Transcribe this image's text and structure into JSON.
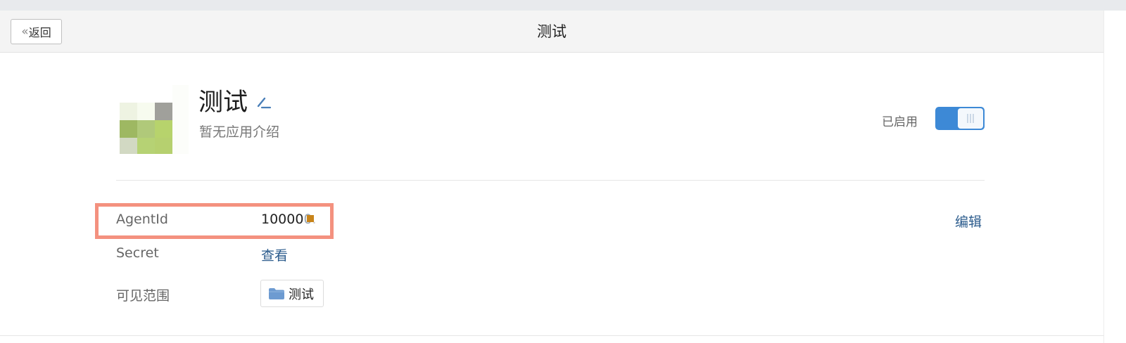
{
  "header": {
    "back_label": "返回",
    "back_chevron": "«",
    "title": "测试"
  },
  "app": {
    "name": "测试",
    "description": "暂无应用介绍",
    "status_label": "已启用",
    "enabled": true,
    "accent_color": "#3d89d6"
  },
  "details": {
    "agentid_label": "AgentId",
    "agentid_value": "10000",
    "agentid_value_suffix": "0",
    "secret_label": "Secret",
    "secret_link": "查看",
    "scope_label": "可见范围",
    "scope_value": "测试",
    "edit_label": "编辑"
  },
  "icons": {
    "back": "double-chevron-left-icon",
    "edit_name": "pencil-icon",
    "scope": "folder-icon",
    "logo": "app-logo-pixelated"
  },
  "colors": {
    "highlight_border": "#f4917f",
    "link": "#2c5c8d",
    "folder": "#6d9bd1"
  }
}
